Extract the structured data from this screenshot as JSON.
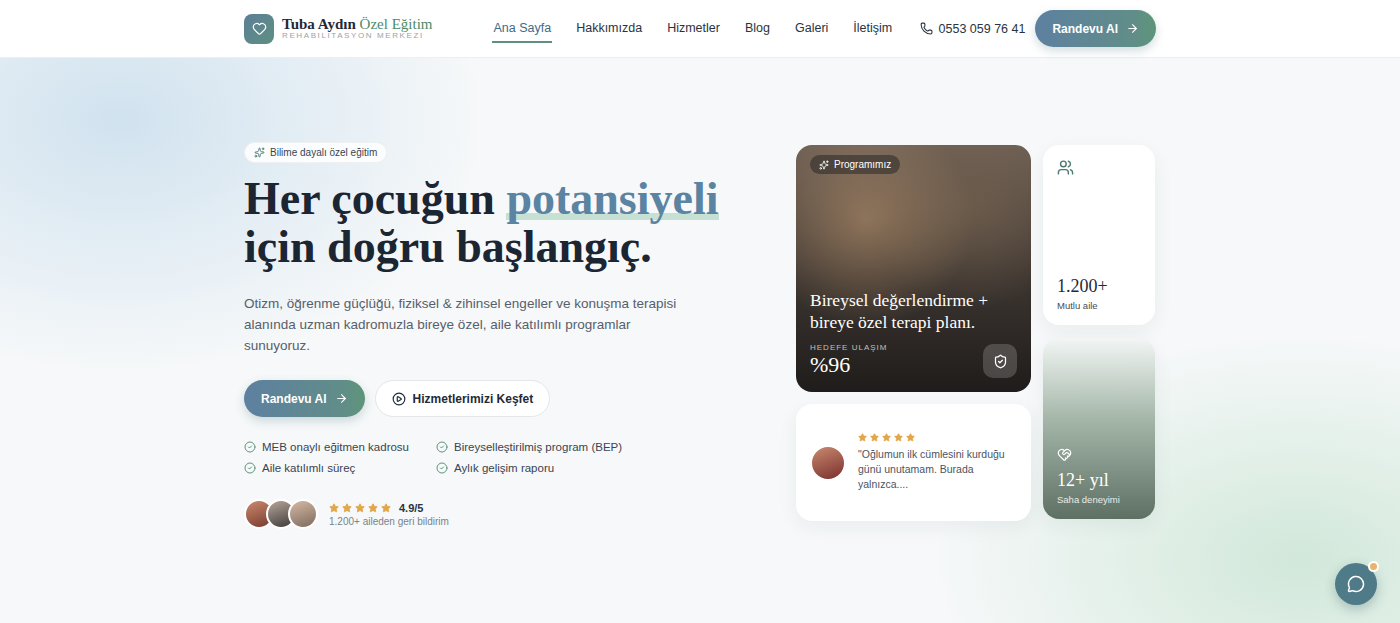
{
  "brand": {
    "name": "Tuba Aydın",
    "accent": "Özel Eğitim",
    "subtitle": "REHABILITASYON MERKEZI"
  },
  "nav": [
    {
      "label": "Ana Sayfa",
      "selected": true
    },
    {
      "label": "Hakkımızda",
      "selected": false
    },
    {
      "label": "Hizmetler",
      "selected": false
    },
    {
      "label": "Blog",
      "selected": false
    },
    {
      "label": "Galeri",
      "selected": false
    },
    {
      "label": "İletişim",
      "selected": false
    }
  ],
  "phone": "0553 059 76 41",
  "header_button": "Randevu Al",
  "hero": {
    "badge": "Bilime dayalı özel eğitim",
    "title_start": "Her çocuğun ",
    "title_highlight": "potansiyeli",
    "title_end": "için doğru başlangıç.",
    "description": "Otizm, öğrenme güçlüğü, fiziksel & zihinsel engeller ve konuşma terapisi alanında uzman kadromuzla bireye özel, aile katılımlı programlar sunuyoruz.",
    "primary_button": "Randevu Al",
    "secondary_button": "Hizmetlerimizi Keşfet",
    "features": [
      "MEB onaylı eğitmen kadrosu",
      "Bireyselleştirilmiş program (BEP)",
      "Aile katılımlı süreç",
      "Aylık gelişim raporu"
    ],
    "rating": {
      "stars": 5,
      "score": "4.9/5",
      "caption": "1.200+ aileden geri bildirim"
    }
  },
  "program_card": {
    "badge": "Programımız",
    "title": "Bireysel değerlendirme + bireye özel terapi planı.",
    "metric_label": "HEDEFE ULAŞIM",
    "metric_value": "%96"
  },
  "stats": [
    {
      "value": "1.200+",
      "label": "Mutlu aile",
      "kind": "light"
    },
    {
      "value": "12+ yıl",
      "label": "Saha deneyimi",
      "kind": "dark"
    }
  ],
  "testimonial": {
    "stars": 5,
    "quote": "\"Oğlumun ilk cümlesini kurduğu günü unutamam. Burada yalnızca...."
  }
}
